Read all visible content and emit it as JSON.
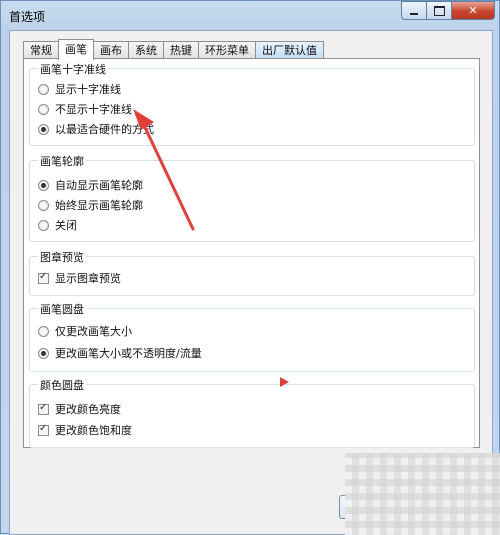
{
  "window": {
    "title": "首选项"
  },
  "tabs": [
    {
      "label": "常规"
    },
    {
      "label": "画笔"
    },
    {
      "label": "画布"
    },
    {
      "label": "系统"
    },
    {
      "label": "热键"
    },
    {
      "label": "环形菜单"
    },
    {
      "label": "出厂默认值"
    }
  ],
  "active_tab": "画笔",
  "groups": {
    "crosshair": {
      "title": "画笔十字准线",
      "options": [
        {
          "label": "显示十字准线",
          "selected": false
        },
        {
          "label": "不显示十字准线",
          "selected": false
        },
        {
          "label": "以最适合硬件的方式",
          "selected": true
        }
      ]
    },
    "outline": {
      "title": "画笔轮廓",
      "options": [
        {
          "label": "自动显示画笔轮廓",
          "selected": true
        },
        {
          "label": "始终显示画笔轮廓",
          "selected": false
        },
        {
          "label": "关闭",
          "selected": false
        }
      ]
    },
    "stamp": {
      "title": "图章预览",
      "options": [
        {
          "label": "显示图章预览",
          "checked": true
        }
      ]
    },
    "brush_ring": {
      "title": "画笔圆盘",
      "options": [
        {
          "label": "仅更改画笔大小",
          "selected": false
        },
        {
          "label": "更改画笔大小或不透明度/流量",
          "selected": true
        }
      ]
    },
    "color_ring": {
      "title": "颜色圆盘",
      "options": [
        {
          "label": "更改颜色亮度",
          "checked": true
        },
        {
          "label": "更改颜色饱和度",
          "checked": true
        }
      ]
    }
  },
  "annotation": {
    "arrow_color": "#e0403a"
  }
}
